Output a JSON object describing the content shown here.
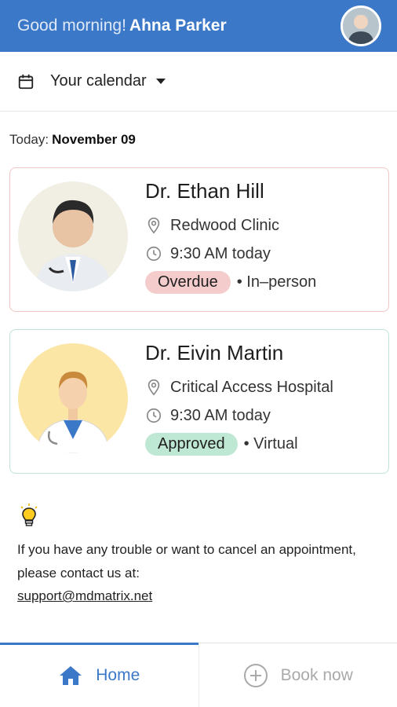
{
  "header": {
    "greeting": "Good morning!",
    "user_name": "Ahna Parker"
  },
  "calendar": {
    "label": "Your calendar"
  },
  "today": {
    "prefix": "Today:",
    "date": "November 09"
  },
  "appointments": [
    {
      "doctor": "Dr. Ethan Hill",
      "location": "Redwood Clinic",
      "time": "9:30 AM today",
      "status": "Overdue",
      "mode": "• In–person"
    },
    {
      "doctor": "Dr. Eivin Martin",
      "location": "Critical Access Hospital",
      "time": "9:30 AM today",
      "status": "Approved",
      "mode": "• Virtual"
    }
  ],
  "help": {
    "message": "If you have any trouble or want to cancel an appointment, please contact us at:",
    "email": "support@mdmatrix.net"
  },
  "tabs": {
    "home": "Home",
    "book": "Book now"
  },
  "colors": {
    "brand": "#3b78c8",
    "overdue": "#f4cccc",
    "approved": "#bfe8d4"
  }
}
